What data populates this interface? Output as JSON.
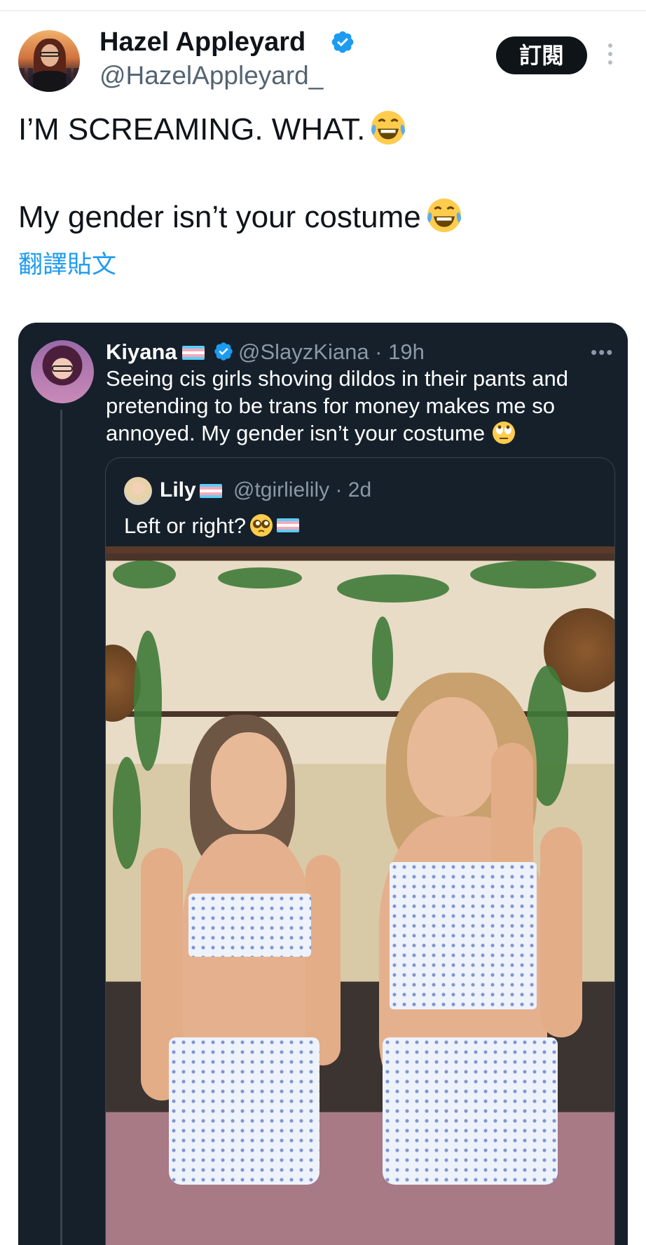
{
  "post": {
    "author_name": "Hazel Appleyard",
    "author_handle": "@HazelAppleyard_",
    "subscribe_label": "訂閱",
    "line1": "I’M SCREAMING. WHAT.",
    "line2": "My gender isn’t your costume",
    "translate_label": "翻譯貼文"
  },
  "quoted": {
    "name": "Kiyana",
    "handle_time": "@SlayzKiana · 19h",
    "more_label": "•••",
    "text": "Seeing cis girls shoving dildos in their pants and pretending to be trans for money makes me so annoyed. My gender isn’t your costume",
    "nested": {
      "name": "Lily",
      "handle_time": "@tgirlielily · 2d",
      "text": "Left or right?"
    }
  },
  "colors": {
    "verified": "#1d9bf0",
    "link": "#1d9bf0",
    "card_bg": "#15202b",
    "flag_blue": "#5bcefa",
    "flag_pink": "#f5a9b8"
  },
  "icons": [
    "verified-badge-icon",
    "more-vertical-icon",
    "laughing-emoji-icon",
    "eye-roll-emoji-icon",
    "pleading-emoji-icon",
    "trans-flag-icon",
    "more-horizontal-icon"
  ]
}
